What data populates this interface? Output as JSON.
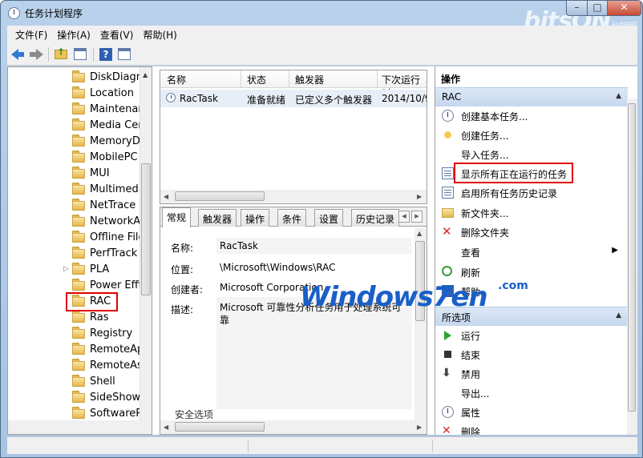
{
  "window": {
    "title": "任务计划程序",
    "watermark": "bitsON",
    "watermark_sub": "比特网"
  },
  "menu": [
    "文件(F)",
    "操作(A)",
    "查看(V)",
    "帮助(H)"
  ],
  "toolbar": {
    "icons": [
      "back-icon",
      "forward-icon",
      "up-folder-icon",
      "show-tree-icon",
      "help-icon",
      "action-pane-icon"
    ]
  },
  "tree": {
    "items": [
      {
        "label": "DiskDiagn",
        "expander": ""
      },
      {
        "label": "Location",
        "expander": ""
      },
      {
        "label": "Maintenan",
        "expander": ""
      },
      {
        "label": "Media Cer",
        "expander": ""
      },
      {
        "label": "MemoryDi",
        "expander": ""
      },
      {
        "label": "MobilePC",
        "expander": ""
      },
      {
        "label": "MUI",
        "expander": ""
      },
      {
        "label": "Multimedia",
        "expander": ""
      },
      {
        "label": "NetTrace",
        "expander": ""
      },
      {
        "label": "NetworkAc",
        "expander": ""
      },
      {
        "label": "Offline File",
        "expander": ""
      },
      {
        "label": "PerfTrack",
        "expander": ""
      },
      {
        "label": "PLA",
        "expander": "▷"
      },
      {
        "label": "Power Effic",
        "expander": ""
      },
      {
        "label": "RAC",
        "expander": ""
      },
      {
        "label": "Ras",
        "expander": ""
      },
      {
        "label": "Registry",
        "expander": ""
      },
      {
        "label": "RemoteAp",
        "expander": ""
      },
      {
        "label": "RemoteAs",
        "expander": ""
      },
      {
        "label": "Shell",
        "expander": ""
      },
      {
        "label": "SideShow",
        "expander": ""
      },
      {
        "label": "SoftwarePr",
        "expander": ""
      }
    ],
    "selected": "RAC"
  },
  "tasklist": {
    "columns": [
      "名称",
      "状态",
      "触发器",
      "下次运行时"
    ],
    "rows": [
      {
        "name": "RacTask",
        "status": "准备就绪",
        "trigger": "已定义多个触发器",
        "next": "2014/10/9"
      }
    ]
  },
  "details": {
    "tabs": [
      "常规",
      "触发器",
      "操作",
      "条件",
      "设置",
      "历史记录"
    ],
    "active_tab": "常规",
    "fields": {
      "name_label": "名称:",
      "name_value": "RacTask",
      "location_label": "位置:",
      "location_value": "\\Microsoft\\Windows\\RAC",
      "author_label": "创建者:",
      "author_value": "Microsoft Corporation",
      "desc_label": "描述:",
      "desc_value": "Microsoft 可靠性分析任务用于处理系统可靠"
    },
    "security_label": "安全选项"
  },
  "actions": {
    "title": "操作",
    "section1": {
      "header": "RAC",
      "items": [
        {
          "label": "创建基本任务...",
          "icon": "create-basic-task-icon"
        },
        {
          "label": "创建任务...",
          "icon": "create-task-icon"
        },
        {
          "label": "导入任务...",
          "icon": ""
        },
        {
          "label": "显示所有正在运行的任务",
          "icon": "running-tasks-icon"
        },
        {
          "label": "启用所有任务历史记录",
          "icon": "history-icon"
        },
        {
          "label": "新文件夹...",
          "icon": "new-folder-icon"
        },
        {
          "label": "删除文件夹",
          "icon": "delete-icon"
        },
        {
          "label": "查看",
          "icon": "",
          "submenu": "▶"
        },
        {
          "label": "刷新",
          "icon": "refresh-icon"
        },
        {
          "label": "帮助",
          "icon": "help-icon"
        }
      ]
    },
    "section2": {
      "header": "所选项",
      "items": [
        {
          "label": "运行",
          "icon": "run-icon"
        },
        {
          "label": "结束",
          "icon": "stop-icon"
        },
        {
          "label": "禁用",
          "icon": "disable-icon"
        },
        {
          "label": "导出...",
          "icon": ""
        },
        {
          "label": "属性",
          "icon": "properties-icon"
        },
        {
          "label": "删除",
          "icon": "delete-icon"
        }
      ]
    }
  },
  "watermark": {
    "text": "Windows7en",
    "suffix": ".com"
  }
}
